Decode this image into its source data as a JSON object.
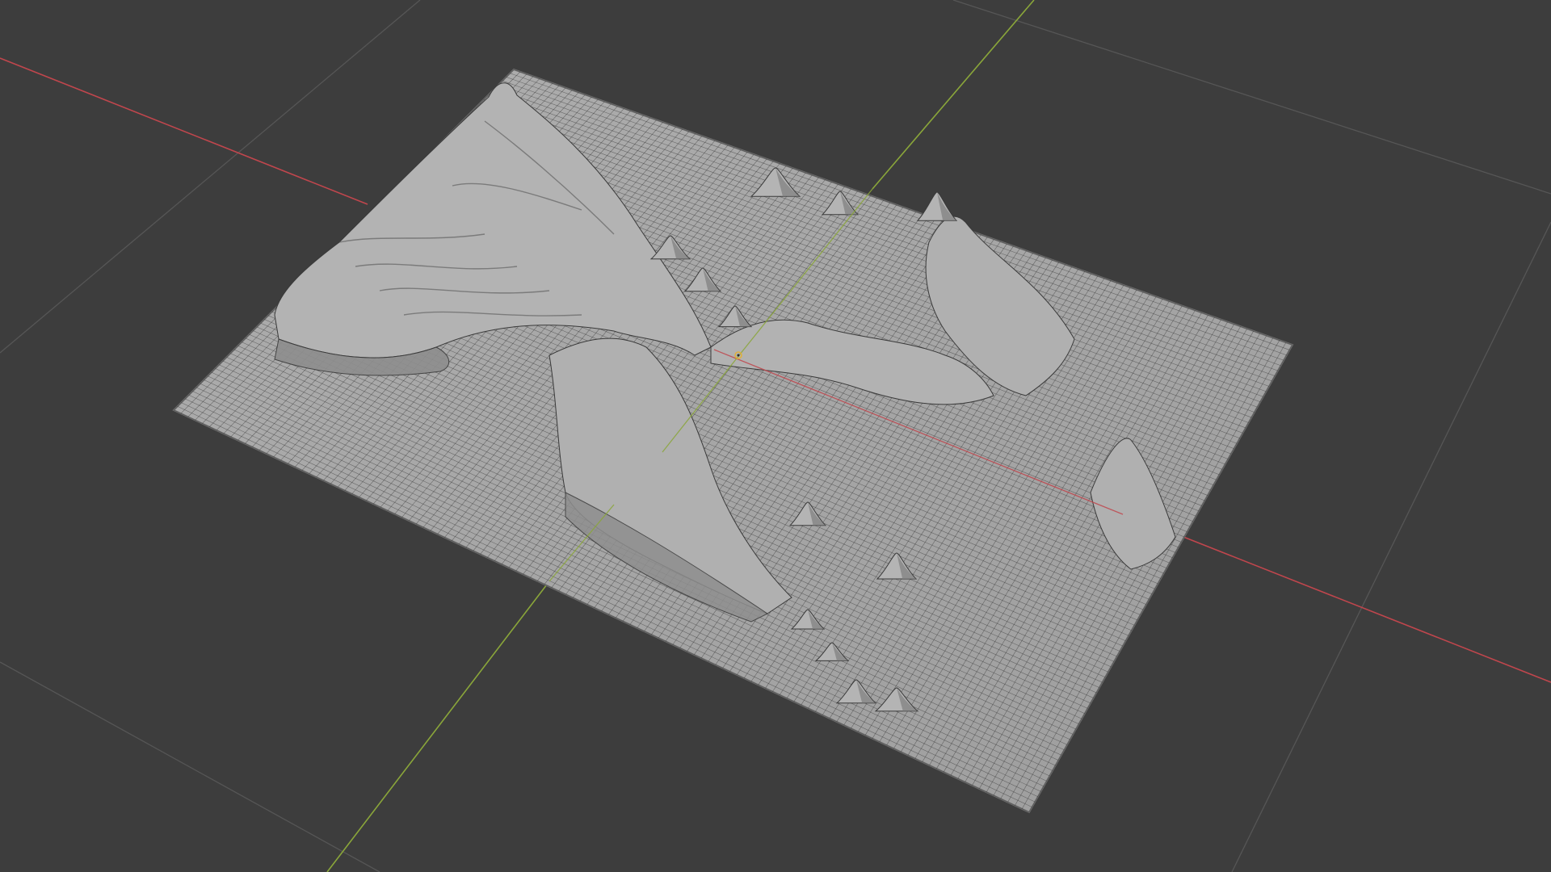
{
  "viewport": {
    "background": "#3d3d3d",
    "grid_color": "#555555",
    "x_axis_color": "#c0464d",
    "y_axis_color": "#8aa63a",
    "origin_color": "#e0b03c"
  },
  "mesh": {
    "object_type": "subdivided-plane-terrain",
    "surface_color": "#a5a5a5",
    "wire_color": "#2a2a2a",
    "shade_light": "#c4c4c4",
    "shade_dark": "#555555"
  },
  "icons": {
    "origin": "object-origin-icon"
  }
}
